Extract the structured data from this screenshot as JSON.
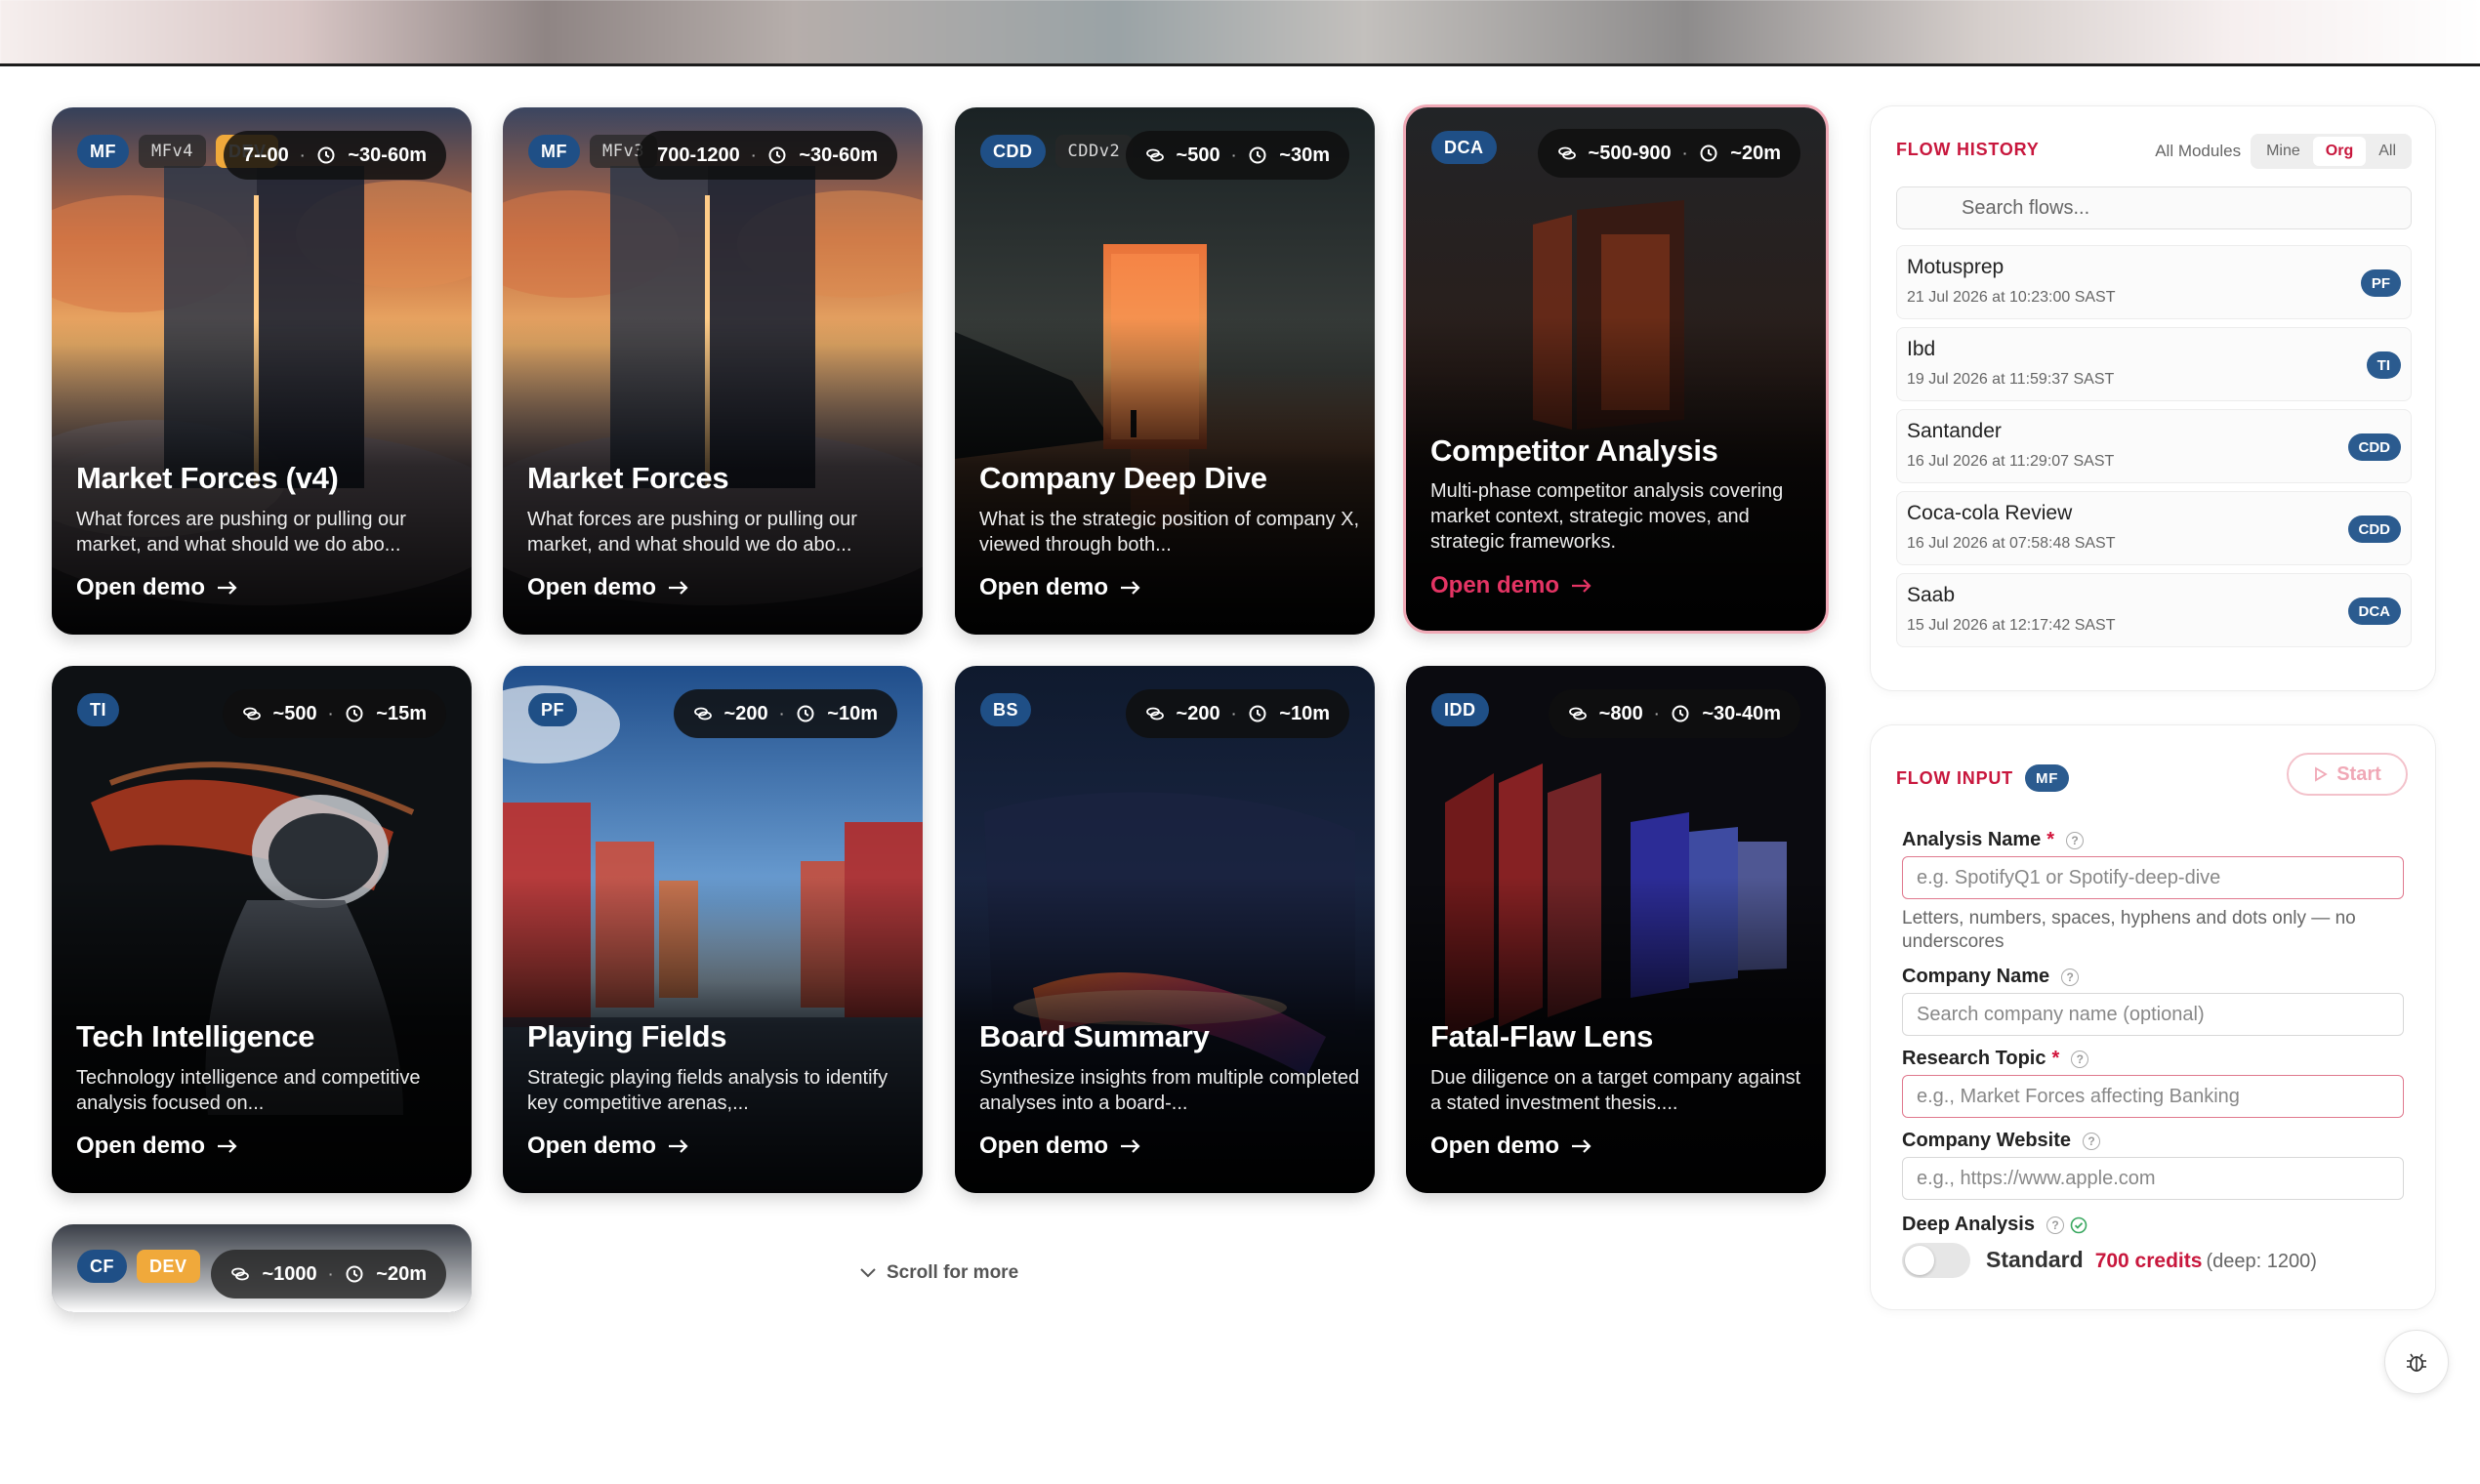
{
  "cards": [
    {
      "badges": [
        "MF",
        "MFv4",
        "DEV"
      ],
      "credits": "7--00",
      "time": "~30-60m",
      "title": "Market Forces (v4)",
      "desc": "What forces are pushing or pulling our market, and what should we do abo...",
      "link": "Open demo"
    },
    {
      "badges": [
        "MF",
        "MFv3"
      ],
      "credits": "700-1200",
      "time": "~30-60m",
      "title": "Market Forces",
      "desc": "What forces are pushing or pulling our market, and what should we do abo...",
      "link": "Open demo"
    },
    {
      "badges": [
        "CDD",
        "CDDv2"
      ],
      "credits": "~500",
      "time": "~30m",
      "title": "Company Deep Dive",
      "desc": "What is the strategic position of company X, viewed through both...",
      "link": "Open demo"
    },
    {
      "badges": [
        "DCA"
      ],
      "credits": "~500-900",
      "time": "~20m",
      "title": "Competitor Analysis",
      "desc": "Multi-phase competitor analysis covering market context, strategic moves, and strategic frameworks.",
      "link": "Open demo"
    },
    {
      "badges": [
        "TI"
      ],
      "credits": "~500",
      "time": "~15m",
      "title": "Tech Intelligence",
      "desc": "Technology intelligence and competitive analysis focused on...",
      "link": "Open demo"
    },
    {
      "badges": [
        "PF"
      ],
      "credits": "~200",
      "time": "~10m",
      "title": "Playing Fields",
      "desc": "Strategic playing fields analysis to identify key competitive arenas,...",
      "link": "Open demo"
    },
    {
      "badges": [
        "BS"
      ],
      "credits": "~200",
      "time": "~10m",
      "title": "Board Summary",
      "desc": "Synthesize insights from multiple completed analyses into a board-...",
      "link": "Open demo"
    },
    {
      "badges": [
        "IDD"
      ],
      "credits": "~800",
      "time": "~30-40m",
      "title": "Fatal-Flaw Lens",
      "desc": "Due diligence on a target company against a stated investment thesis....",
      "link": "Open demo"
    },
    {
      "badges": [
        "CF",
        "DEV"
      ],
      "credits": "~1000",
      "time": "~20m"
    }
  ],
  "scroll_more": "Scroll for more",
  "history": {
    "title": "FLOW HISTORY",
    "scope_label": "All Modules",
    "segments": [
      "Mine",
      "Org",
      "All"
    ],
    "search_placeholder": "Search flows...",
    "items": [
      {
        "name": "Motusprep",
        "date": "21 Jul 2026 at 10:23:00 SAST",
        "tag": "PF"
      },
      {
        "name": "Ibd",
        "date": "19 Jul 2026 at 11:59:37 SAST",
        "tag": "TI"
      },
      {
        "name": "Santander",
        "date": "16 Jul 2026 at 11:29:07 SAST",
        "tag": "CDD"
      },
      {
        "name": "Coca-cola Review",
        "date": "16 Jul 2026 at 07:58:48 SAST",
        "tag": "CDD"
      },
      {
        "name": "Saab",
        "date": "15 Jul 2026 at 12:17:42 SAST",
        "tag": "DCA"
      }
    ]
  },
  "flow_input": {
    "title": "FLOW INPUT",
    "module_tag": "MF",
    "start_label": "Start",
    "analysis_name_label": "Analysis Name",
    "analysis_name_placeholder": "e.g. SpotifyQ1 or Spotify-deep-dive",
    "analysis_name_hint": "Letters, numbers, spaces, hyphens and dots only — no underscores",
    "company_name_label": "Company Name",
    "company_name_placeholder": "Search company name (optional)",
    "research_topic_label": "Research Topic",
    "research_topic_placeholder": "e.g., Market Forces affecting Banking",
    "company_website_label": "Company Website",
    "company_website_placeholder": "e.g., https://www.apple.com",
    "deep_analysis_label": "Deep Analysis",
    "mode_label": "Standard",
    "credits_label": "700 credits",
    "deep_note": "(deep: 1200)"
  },
  "colors": {
    "accent": "#c8173d",
    "badge": "#1f4f86",
    "dev": "#f0a93b"
  }
}
